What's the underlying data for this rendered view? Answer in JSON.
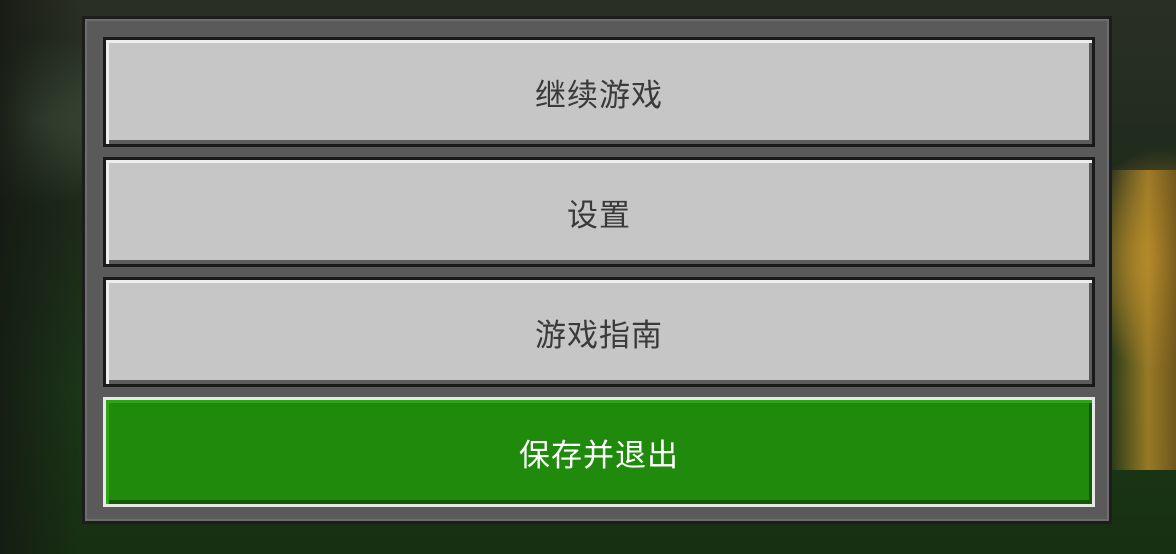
{
  "pause_menu": {
    "buttons": [
      {
        "label": "继续游戏",
        "style": "gray"
      },
      {
        "label": "设置",
        "style": "gray"
      },
      {
        "label": "游戏指南",
        "style": "gray"
      },
      {
        "label": "保存并退出",
        "style": "green"
      }
    ]
  },
  "colors": {
    "button_gray": "#c6c6c6",
    "button_green": "#1f8a0c",
    "panel": "#5a5a5a"
  }
}
